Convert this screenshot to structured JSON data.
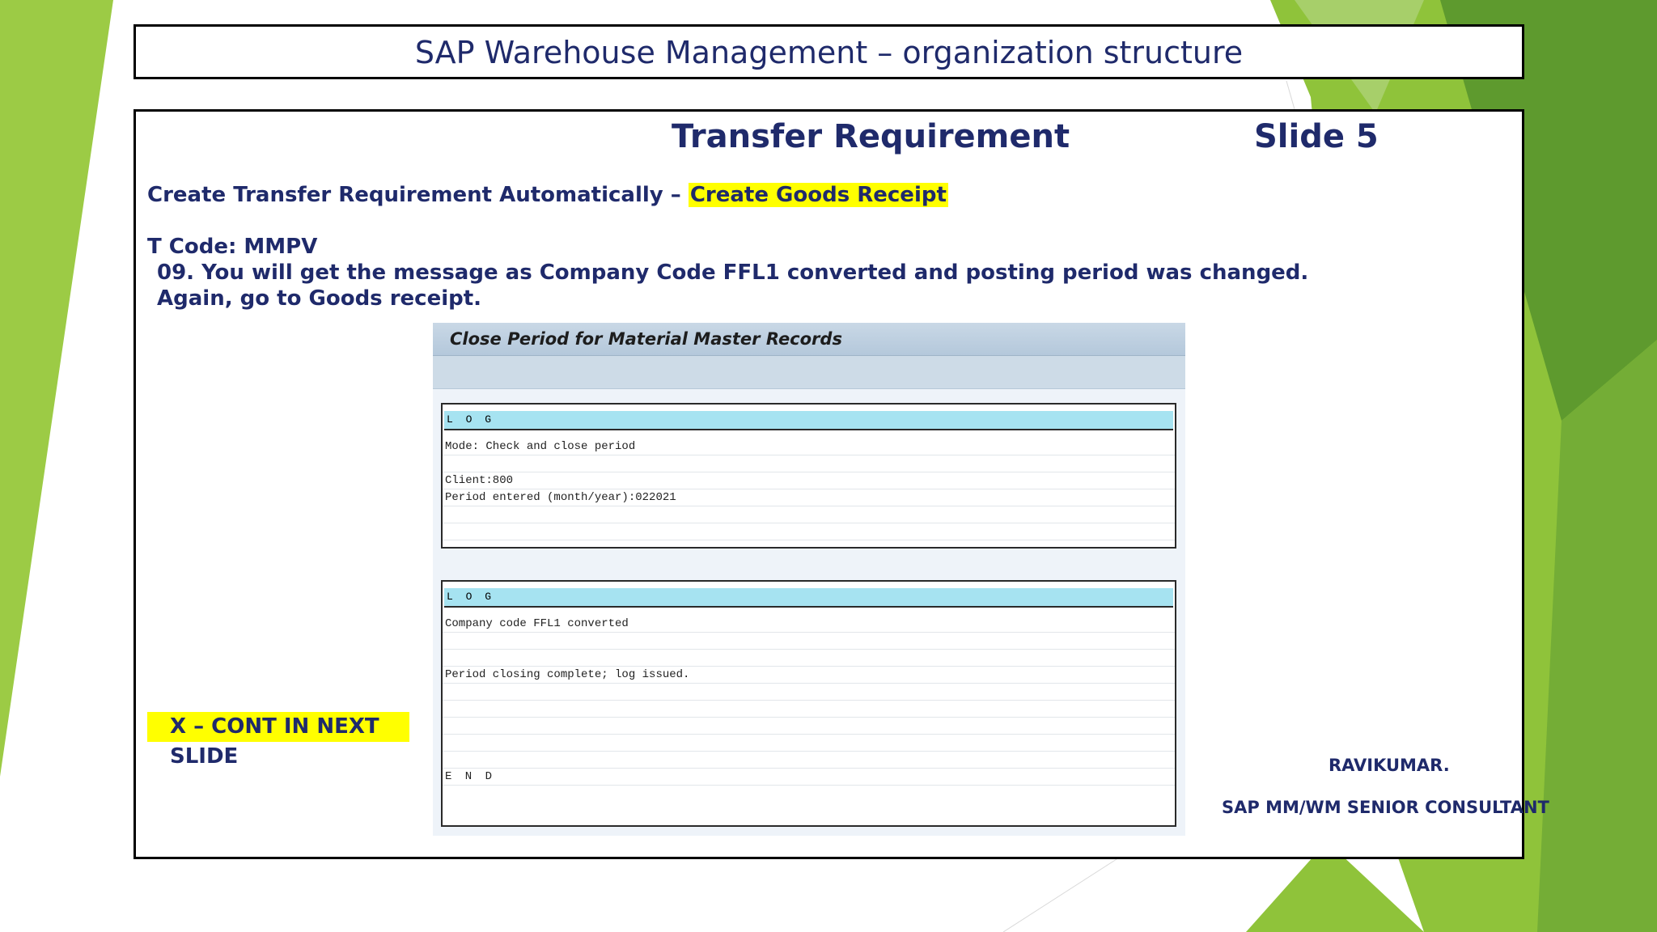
{
  "slide": {
    "title": "SAP Warehouse Management – organization structure",
    "heading": "Transfer Requirement",
    "slide_number": "Slide 5",
    "line1_prefix": "Create Transfer Requirement Automatically – ",
    "line1_highlight": "Create Goods Receipt",
    "tcode": "T Code: MMPV",
    "step": "09. You will get the message as Company Code FFL1 converted and posting period was changed.",
    "step2": "Again, go to Goods receipt.",
    "cont_note": "X – CONT IN NEXT SLIDE",
    "author_name": "RAVIKUMAR.",
    "author_role": "SAP MM/WM  SENIOR CONSULTANT"
  },
  "sap": {
    "window_title": "Close Period for Material Master Records",
    "log1": {
      "header": "L O G",
      "rows": [
        "Mode: Check and close period",
        "",
        "Client:800",
        "Period entered (month/year):022021",
        "",
        ""
      ]
    },
    "log2": {
      "header": "L O G",
      "rows": [
        "Company code FFL1 converted",
        "",
        "",
        "Period closing complete; log issued.",
        "",
        "",
        "",
        "",
        "",
        "E N D"
      ]
    }
  },
  "colors": {
    "accent_green": "#8cc63f",
    "dark_green": "#5f9c2f",
    "highlight": "#ffff00",
    "navy_text": "#1f2a6b",
    "log_header": "#a6e3f1"
  }
}
